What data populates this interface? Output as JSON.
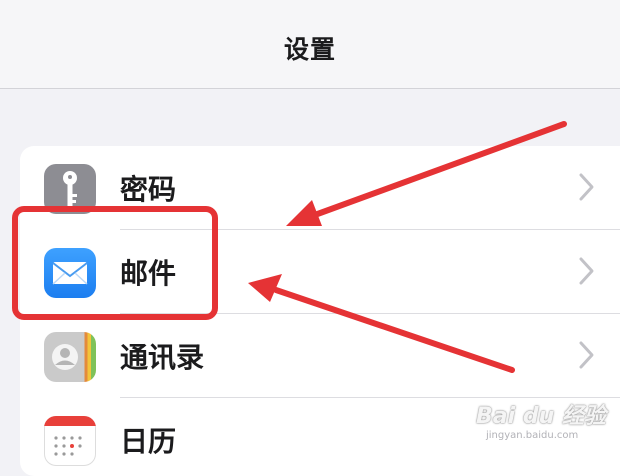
{
  "header": {
    "title": "设置"
  },
  "settings": {
    "rows": [
      {
        "label": "密码",
        "icon": "key-icon"
      },
      {
        "label": "邮件",
        "icon": "mail-icon"
      },
      {
        "label": "通讯录",
        "icon": "contacts-icon"
      },
      {
        "label": "日历",
        "icon": "calendar-icon"
      }
    ]
  },
  "annotation": {
    "color": "#e53335"
  },
  "watermark": {
    "brand": "Bai du 经验",
    "url": "jingyan.baidu.com"
  }
}
